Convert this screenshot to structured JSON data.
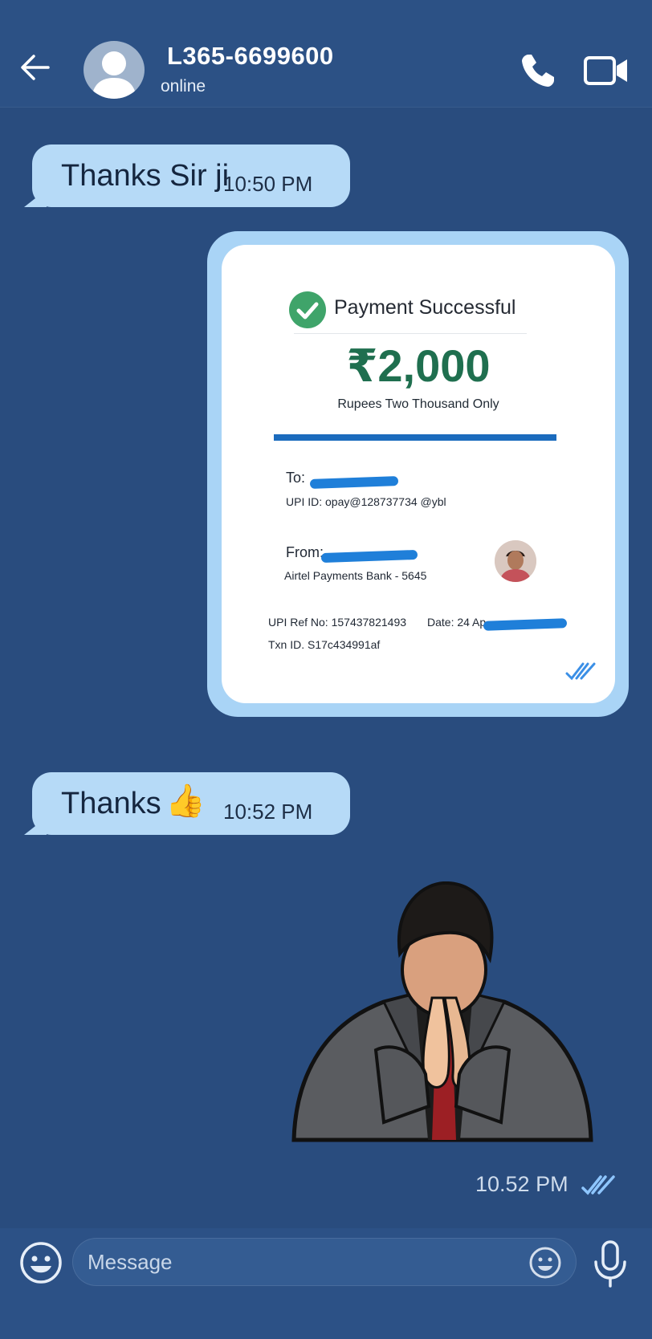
{
  "header": {
    "contact_name": "L365-6699600",
    "status": "online"
  },
  "messages": [
    {
      "text": "Thanks Sir ji",
      "time": "10:50 PM"
    },
    {
      "text": "Thanks",
      "emoji": "👍",
      "time": "10:52 PM"
    }
  ],
  "payment": {
    "status": "Payment Successful",
    "amount": "₹2,000",
    "amount_words": "Rupees Two Thousand Only",
    "to_label": "To:",
    "upi_id": "UPI ID: opay@128737734 @ybl",
    "from_label": "From:",
    "bank": "Airtel Payments Bank - 5645",
    "ref": "UPI Ref No: 157437821493",
    "date_label": "Date: 24 Ap",
    "txn": "Txn ID. S17c434991af"
  },
  "sticker": {
    "time": "10.52 PM"
  },
  "composer": {
    "placeholder": "Message"
  },
  "colors": {
    "background": "#294c7e",
    "bubble": "#b6daf7",
    "tick": "#8ec6ff",
    "amount": "#1f6f4f",
    "success": "#3fa46a",
    "redaction": "#1f7fd9"
  }
}
